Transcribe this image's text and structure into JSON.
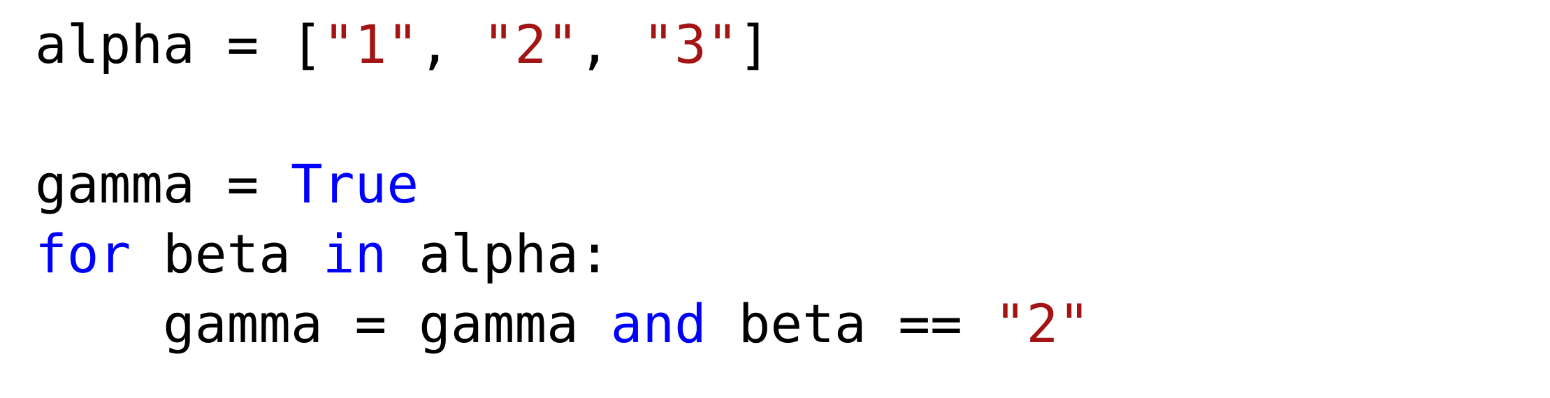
{
  "code": {
    "colors": {
      "plain": "#000000",
      "keyword": "#0000ff",
      "string": "#a31515",
      "background": "#ffffff"
    },
    "lines": [
      {
        "tokens": [
          {
            "text": "alpha = [",
            "kind": "plain"
          },
          {
            "text": "\"1\"",
            "kind": "string"
          },
          {
            "text": ", ",
            "kind": "plain"
          },
          {
            "text": "\"2\"",
            "kind": "string"
          },
          {
            "text": ", ",
            "kind": "plain"
          },
          {
            "text": "\"3\"",
            "kind": "string"
          },
          {
            "text": "]",
            "kind": "plain"
          }
        ]
      },
      {
        "tokens": []
      },
      {
        "tokens": [
          {
            "text": "gamma = ",
            "kind": "plain"
          },
          {
            "text": "True",
            "kind": "keyword"
          }
        ]
      },
      {
        "tokens": [
          {
            "text": "for",
            "kind": "keyword"
          },
          {
            "text": " beta ",
            "kind": "plain"
          },
          {
            "text": "in",
            "kind": "keyword"
          },
          {
            "text": " alpha:",
            "kind": "plain"
          }
        ]
      },
      {
        "tokens": [
          {
            "text": "    gamma = gamma ",
            "kind": "plain"
          },
          {
            "text": "and",
            "kind": "keyword"
          },
          {
            "text": " beta == ",
            "kind": "plain"
          },
          {
            "text": "\"2\"",
            "kind": "string"
          }
        ]
      }
    ]
  }
}
